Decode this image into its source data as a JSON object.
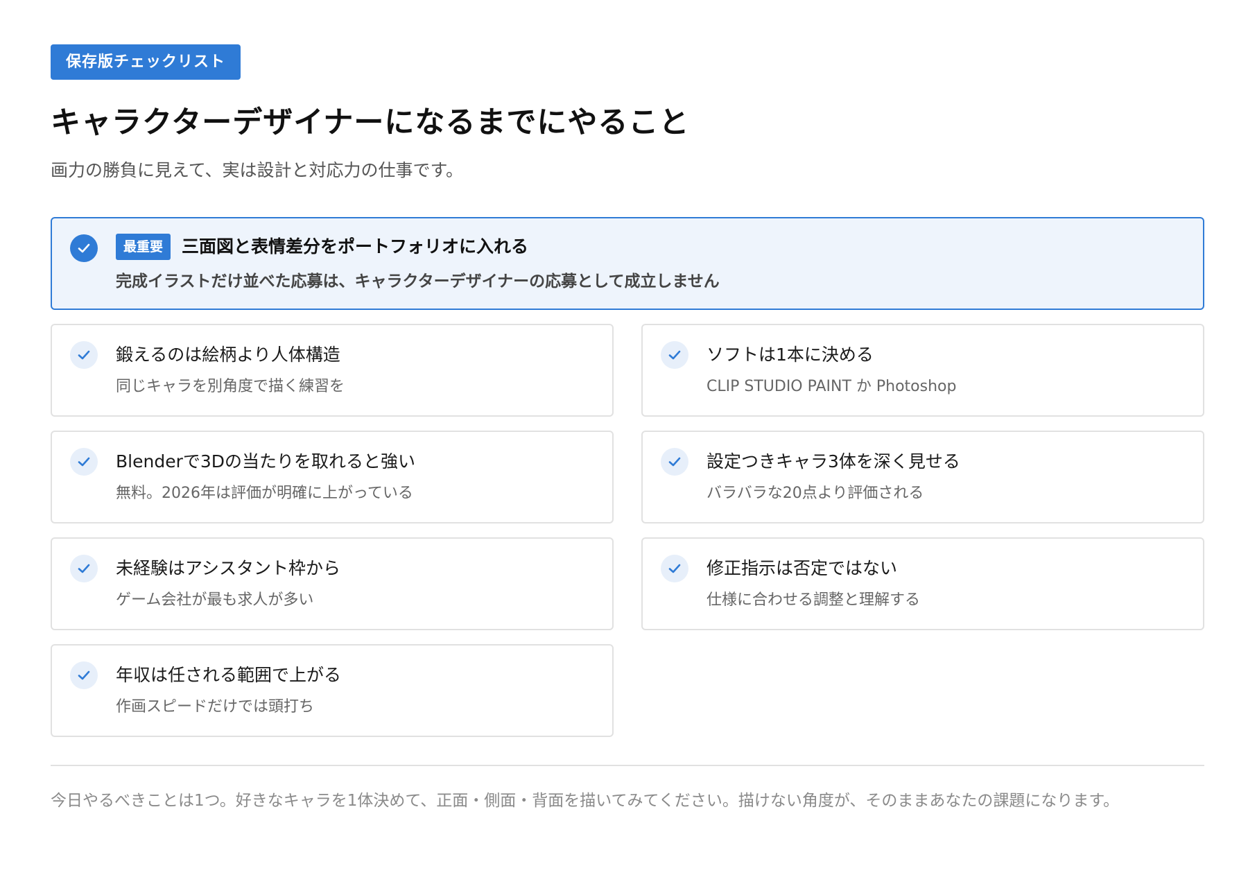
{
  "tag": "保存版チェックリスト",
  "title": "キャラクターデザイナーになるまでにやること",
  "subtitle": "画力の勝負に見えて、実は設計と対応力の仕事です。",
  "featured": {
    "badge": "最重要",
    "title": "三面図と表情差分をポートフォリオに入れる",
    "description": "完成イラストだけ並べた応募は、キャラクターデザイナーの応募として成立しません",
    "icon": "check-circle-icon",
    "checked": true
  },
  "items": [
    {
      "title": "鍛えるのは絵柄より人体構造",
      "description": "同じキャラを別角度で描く練習を",
      "icon": "check-icon",
      "checked": true
    },
    {
      "title": "ソフトは1本に決める",
      "description": "CLIP STUDIO PAINT か Photoshop",
      "icon": "check-icon",
      "checked": true
    },
    {
      "title": "Blenderで3Dの当たりを取れると強い",
      "description": "無料。2026年は評価が明確に上がっている",
      "icon": "check-icon",
      "checked": true
    },
    {
      "title": "設定つきキャラ3体を深く見せる",
      "description": "バラバラな20点より評価される",
      "icon": "check-icon",
      "checked": true
    },
    {
      "title": "未経験はアシスタント枠から",
      "description": "ゲーム会社が最も求人が多い",
      "icon": "check-icon",
      "checked": true
    },
    {
      "title": "修正指示は否定ではない",
      "description": "仕様に合わせる調整と理解する",
      "icon": "check-icon",
      "checked": true
    },
    {
      "title": "年収は任される範囲で上がる",
      "description": "作画スピードだけでは頭打ち",
      "icon": "check-icon",
      "checked": true
    }
  ],
  "footer": "今日やるべきことは1つ。好きなキャラを1体決めて、正面・側面・背面を描いてみてください。描けない角度が、そのままあなたの課題になります。",
  "colors": {
    "accent": "#2f7bd6",
    "featured_background": "#eef4fc",
    "check_soft_background": "#e7effa",
    "card_border": "#e1e1e1"
  }
}
